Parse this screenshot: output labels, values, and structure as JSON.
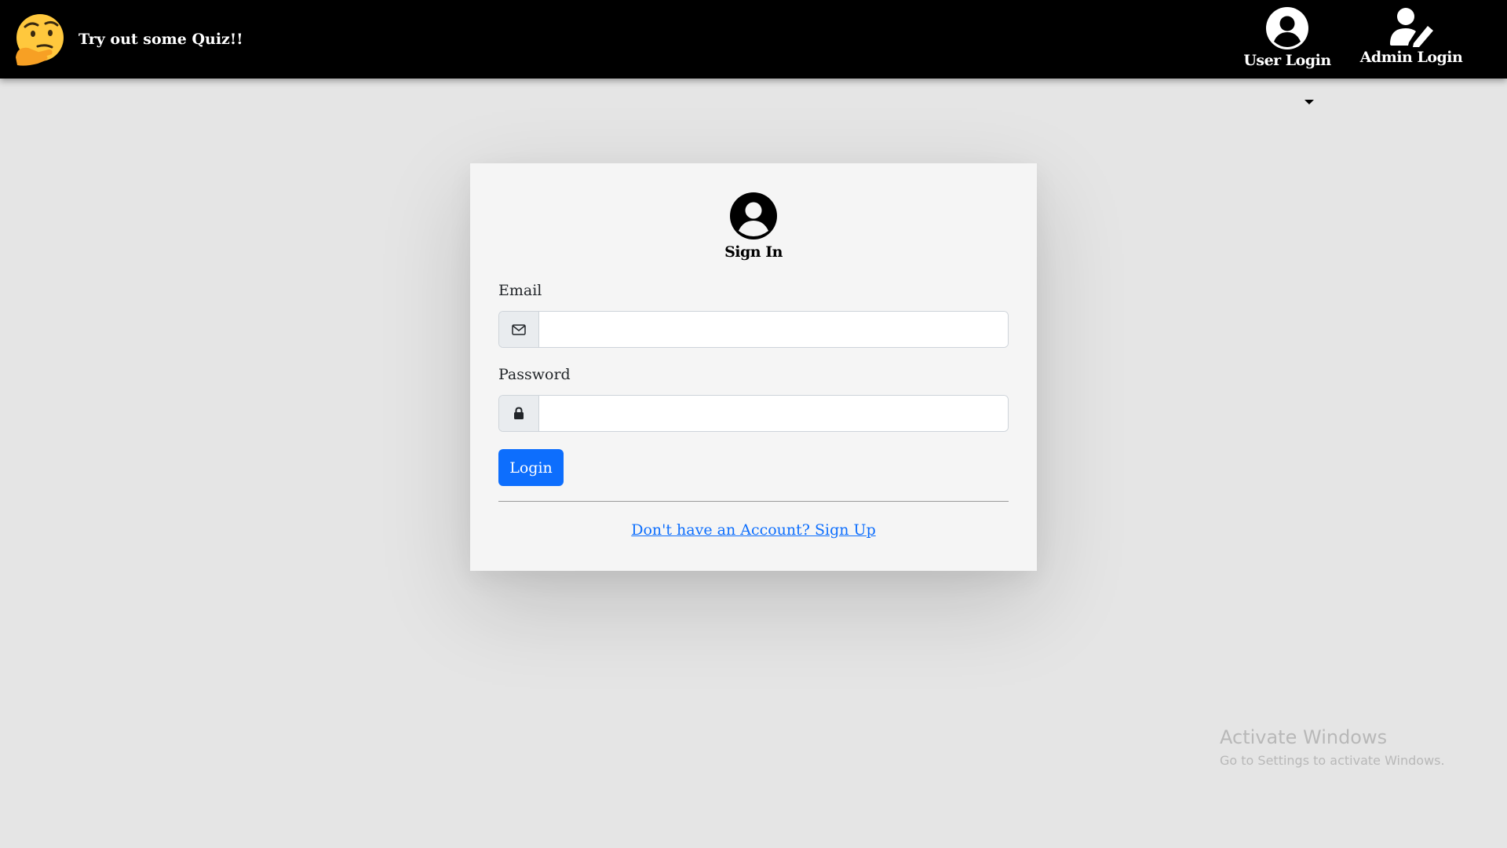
{
  "navbar": {
    "brand_text": "Try out some Quiz!!",
    "brand_icon": "thinking-face-icon",
    "items": [
      {
        "label": "User Login",
        "icon": "user-circle-icon"
      },
      {
        "label": "Admin Login",
        "icon": "user-edit-icon"
      }
    ]
  },
  "login_form": {
    "title": "Sign In",
    "header_icon": "user-circle-icon",
    "email": {
      "label": "Email",
      "value": "",
      "placeholder": "",
      "icon": "envelope-icon"
    },
    "password": {
      "label": "Password",
      "value": "",
      "placeholder": "",
      "icon": "lock-icon"
    },
    "submit_label": "Login",
    "signup_link": "Don't have an Account? Sign Up"
  },
  "watermark": {
    "title": "Activate Windows",
    "subtitle": "Go to Settings to activate Windows."
  },
  "colors": {
    "navbar_bg": "#000000",
    "page_bg": "#e5e5e5",
    "card_bg": "#f5f5f5",
    "primary": "#0d6efd"
  }
}
